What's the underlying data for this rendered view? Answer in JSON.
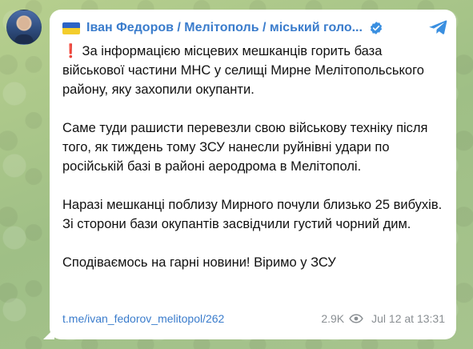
{
  "post": {
    "channel_name": "Іван Федоров / Мелітополь / міський голо...",
    "exclaim": "❗",
    "paragraphs": [
      "За інформацією місцевих мешканців горить база військової частини МНС у селищі Мирне Мелітопольського району, яку захопили окупанти.",
      "Саме туди рашисти перевезли свою військову техніку після того, як тиждень тому ЗСУ нанесли руйнівні удари по російській базі в районі аеродрома в Мелітополі.",
      "Наразі мешканці поблизу Мирного почули близько 25 вибухів. Зі сторони бази окупантів засвідчили густий чорний дим.",
      "Сподіваємось на гарні новини! Віримо у ЗСУ"
    ],
    "link": "t.me/ivan_fedorov_melitopol/262",
    "views": "2.9K",
    "date": "Jul 12 at 13:31"
  },
  "icons": {
    "flag": "ukraine-flag-icon",
    "verified": "verified-badge-icon",
    "share": "telegram-share-icon",
    "views": "eye-icon"
  },
  "colors": {
    "accent": "#3a7ccc",
    "meta": "#8a8f93",
    "flag_blue": "#2b63c6",
    "flag_yellow": "#f3cd2c",
    "exclaim": "#d92e2e"
  }
}
